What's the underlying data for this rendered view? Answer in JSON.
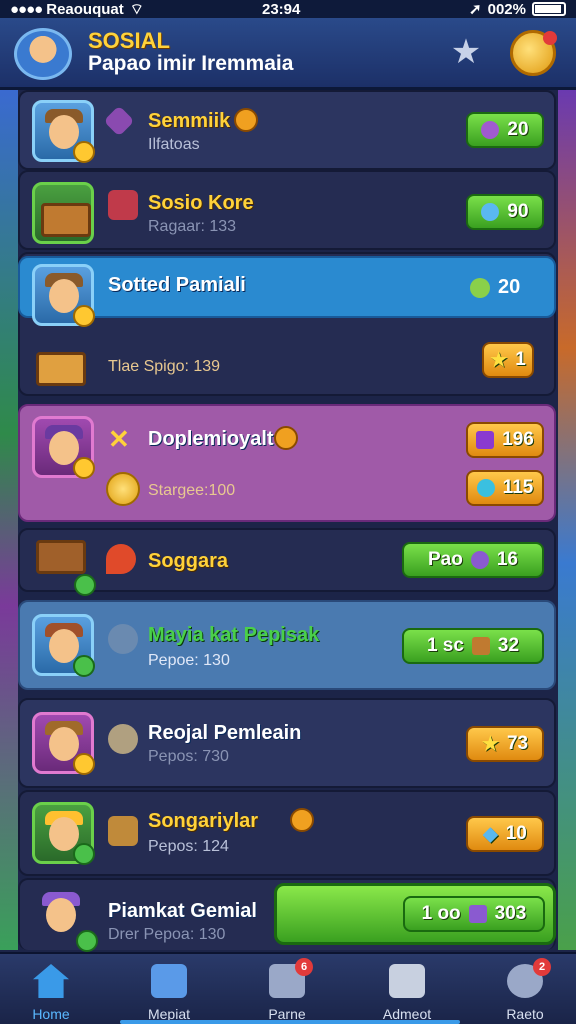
{
  "status": {
    "carrier": "Reaouquat",
    "time": "23:94",
    "battery": "002%"
  },
  "header": {
    "title": "SOSIAL",
    "subtitle": "Papao imir Iremmaia"
  },
  "rows": [
    {
      "title": "Semmiik",
      "sub": "Ilfatoas",
      "value": "20"
    },
    {
      "title": "Sosio Kore",
      "sub": "Ragaar: 133",
      "value": "90"
    },
    {
      "title": "Sotted Pamiali",
      "value": "20"
    },
    {
      "sub": "Tlae Spigo: 139",
      "value": "1"
    },
    {
      "title": "Doplemioyalt",
      "sub": "Stargee:100",
      "value": "196",
      "value2": "115"
    },
    {
      "title": "Soggara",
      "pill_text": "Pao",
      "value": "16"
    },
    {
      "title": "Mayia kat Pepisak",
      "sub": "Pepoe: 130",
      "pill_text": "1 sc",
      "value": "32"
    },
    {
      "title": "Reojal Pemleain",
      "sub": "Pepos: 730",
      "value": "73"
    },
    {
      "title": "Songariylar",
      "sub": "Pepos: 124",
      "value": "10"
    },
    {
      "title": "Piamkat Gemial",
      "sub": "Drer Pepoa: 130",
      "pill_text": "1 oo",
      "value": "303"
    }
  ],
  "tabs": [
    {
      "label": "Home",
      "active": true
    },
    {
      "label": "Mepiat"
    },
    {
      "label": "Parne",
      "badge": "6"
    },
    {
      "label": "Admeot"
    },
    {
      "label": "Raeto",
      "badge": "2"
    }
  ],
  "colors": {
    "accent": "#3a9ae8",
    "gold": "#ffd23a",
    "green": "#3aa020",
    "orange": "#e08a10"
  }
}
